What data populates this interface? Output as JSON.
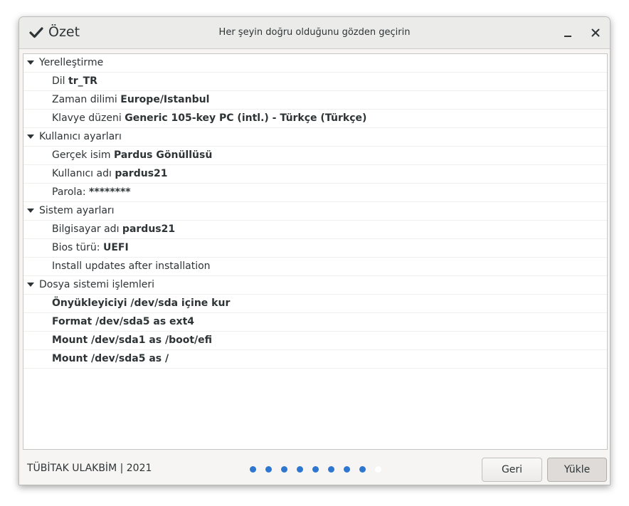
{
  "window": {
    "title": "Özet",
    "subtitle": "Her şeyin doğru olduğunu gözden geçirin"
  },
  "summary": [
    {
      "label": "Yerelleştirme",
      "items": [
        {
          "prefix": "Dil ",
          "value": "tr_TR"
        },
        {
          "prefix": "Zaman dilimi ",
          "value": "Europe/Istanbul"
        },
        {
          "prefix": "Klavye düzeni ",
          "value": "Generic 105-key PC (intl.) - Türkçe (Türkçe)"
        }
      ]
    },
    {
      "label": "Kullanıcı ayarları",
      "items": [
        {
          "prefix": "Gerçek isim ",
          "value": "Pardus Gönüllüsü"
        },
        {
          "prefix": "Kullanıcı adı ",
          "value": "pardus21"
        },
        {
          "prefix": "Parola: ",
          "value": "********"
        }
      ]
    },
    {
      "label": "Sistem ayarları",
      "items": [
        {
          "prefix": "Bilgisayar adı ",
          "value": "pardus21"
        },
        {
          "prefix": "Bios türü: ",
          "value": "UEFI"
        },
        {
          "prefix": "Install updates after installation",
          "value": ""
        }
      ]
    },
    {
      "label": "Dosya sistemi işlemleri",
      "items": [
        {
          "prefix": "",
          "value": "Önyükleyiciyi /dev/sda içine kur"
        },
        {
          "prefix": "",
          "value": "Format /dev/sda5 as ext4"
        },
        {
          "prefix": "",
          "value": "Mount /dev/sda1 as /boot/efi"
        },
        {
          "prefix": "",
          "value": "Mount /dev/sda5 as /"
        }
      ]
    }
  ],
  "footer": {
    "credit": "TÜBİTAK ULAKBİM | 2021",
    "back_label": "Geri",
    "install_label": "Yükle",
    "progress": {
      "total_steps": 9,
      "completed_steps": 8,
      "active_color": "#2e77d0"
    }
  }
}
